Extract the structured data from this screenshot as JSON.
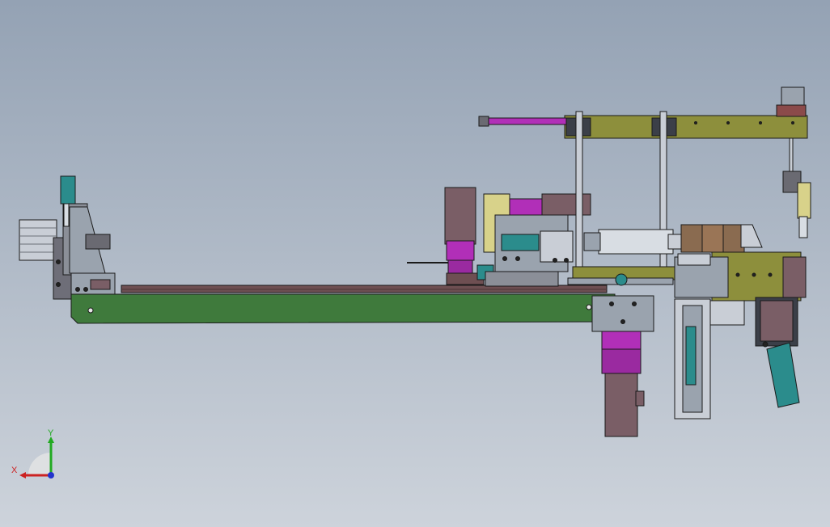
{
  "viewport": {
    "background_top": "#94a2b4",
    "background_bottom": "#cdd3db"
  },
  "model": {
    "colors": {
      "base_plate": "#3f7a3c",
      "rail": "#6e4f52",
      "frame_olive": "#8d8f3c",
      "magenta": "#b12fb8",
      "teal": "#2b8c8c",
      "grey_block": "#9aa3ae",
      "dark_mauve": "#7a5e66",
      "pale_yellow": "#d8d28a",
      "steel": "#c9ced6"
    }
  },
  "triad": {
    "x_label": "X",
    "y_label": "Y",
    "x_color": "#cc2222",
    "y_color": "#22aa22",
    "z_color": "#2233cc"
  }
}
